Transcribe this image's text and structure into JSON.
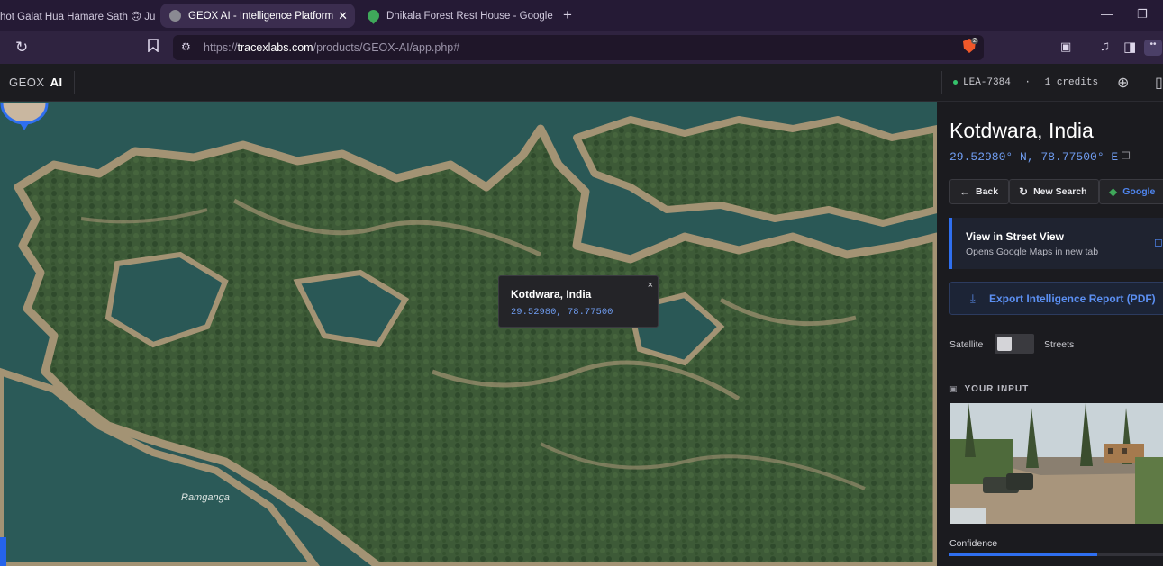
{
  "browser": {
    "tabs": [
      {
        "title": "hot Galat Hua Hamare Sath 🙃 Ju"
      },
      {
        "title": "GEOX AI - Intelligence Platform"
      },
      {
        "title": "Dhikala Forest Rest House - Google M"
      }
    ],
    "new_tab_symbol": "+",
    "url_domain": "tracexlabs.com",
    "url_prefix": "https://",
    "url_path": "/products/GEOX-AI/app.php#",
    "shield_badge": "2"
  },
  "app": {
    "brand_left": "GEOX",
    "brand_right": "AI",
    "user_id": "LEA-7384",
    "separator": "·",
    "credits": "1 credits"
  },
  "map": {
    "place_label": "Ramganga",
    "popup": {
      "title": "Kotdwara, India",
      "coords": "29.52980, 78.77500",
      "close": "×"
    },
    "colors": {
      "water": "#2a5856",
      "forest": "#3c5a37",
      "ridge": "#9a8b6e",
      "pin": "#2f6ff0"
    }
  },
  "panel": {
    "location_title": "Kotdwara, India",
    "coordinates": "29.52980° N, 78.77500° E",
    "buttons": {
      "back": "Back",
      "new_search": "New Search",
      "google": "Google"
    },
    "street_view": {
      "title": "View in Street View",
      "subtitle": "Opens Google Maps in new tab"
    },
    "export_label": "Export Intelligence Report (PDF)",
    "toggle": {
      "left": "Satellite",
      "right": "Streets",
      "state": "satellite"
    },
    "your_input_heading": "YOUR INPUT",
    "confidence_label": "Confidence",
    "confidence_fill_fraction": 0.69
  },
  "icons": [
    "reload-icon",
    "bookmark-icon",
    "site-settings-icon",
    "brave-shield-icon",
    "reader-icon",
    "music-icon",
    "sidebar-icon",
    "wallet-icon",
    "plus-circle-icon",
    "back-arrow-icon",
    "search-refresh-icon",
    "google-maps-icon",
    "external-link-icon",
    "download-icon",
    "copy-icon",
    "close-icon",
    "location-pin-icon",
    "image-icon"
  ]
}
